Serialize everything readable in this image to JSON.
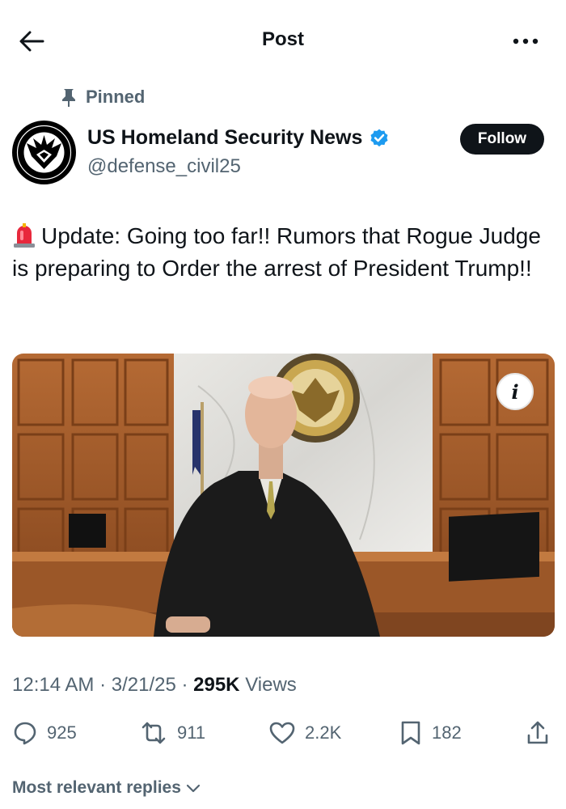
{
  "header": {
    "title": "Post"
  },
  "post": {
    "pinned_label": "Pinned",
    "author_name": "US Homeland Security News",
    "author_handle": "@defense_civil25",
    "follow_label": "Follow",
    "text": "Update: Going too far!! Rumors that Rogue Judge is preparing to Order the arrest of President Trump!!",
    "time": "12:14 AM",
    "date": "3/21/25",
    "views_count": "295K",
    "views_label": "Views",
    "separator": " · "
  },
  "actions": {
    "replies": "925",
    "reposts": "911",
    "likes": "2.2K",
    "bookmarks": "182"
  },
  "replies_sort": {
    "label": "Most relevant replies"
  },
  "colors": {
    "text": "#0f1419",
    "muted": "#536471",
    "verified": "#1d9bf0",
    "follow_bg": "#0f1419"
  },
  "icons": [
    "back-arrow-icon",
    "more-icon",
    "pin-icon",
    "verified-badge-icon",
    "siren-emoji",
    "info-icon",
    "reply-icon",
    "repost-icon",
    "like-icon",
    "bookmark-icon",
    "share-icon",
    "chevron-down-icon"
  ]
}
